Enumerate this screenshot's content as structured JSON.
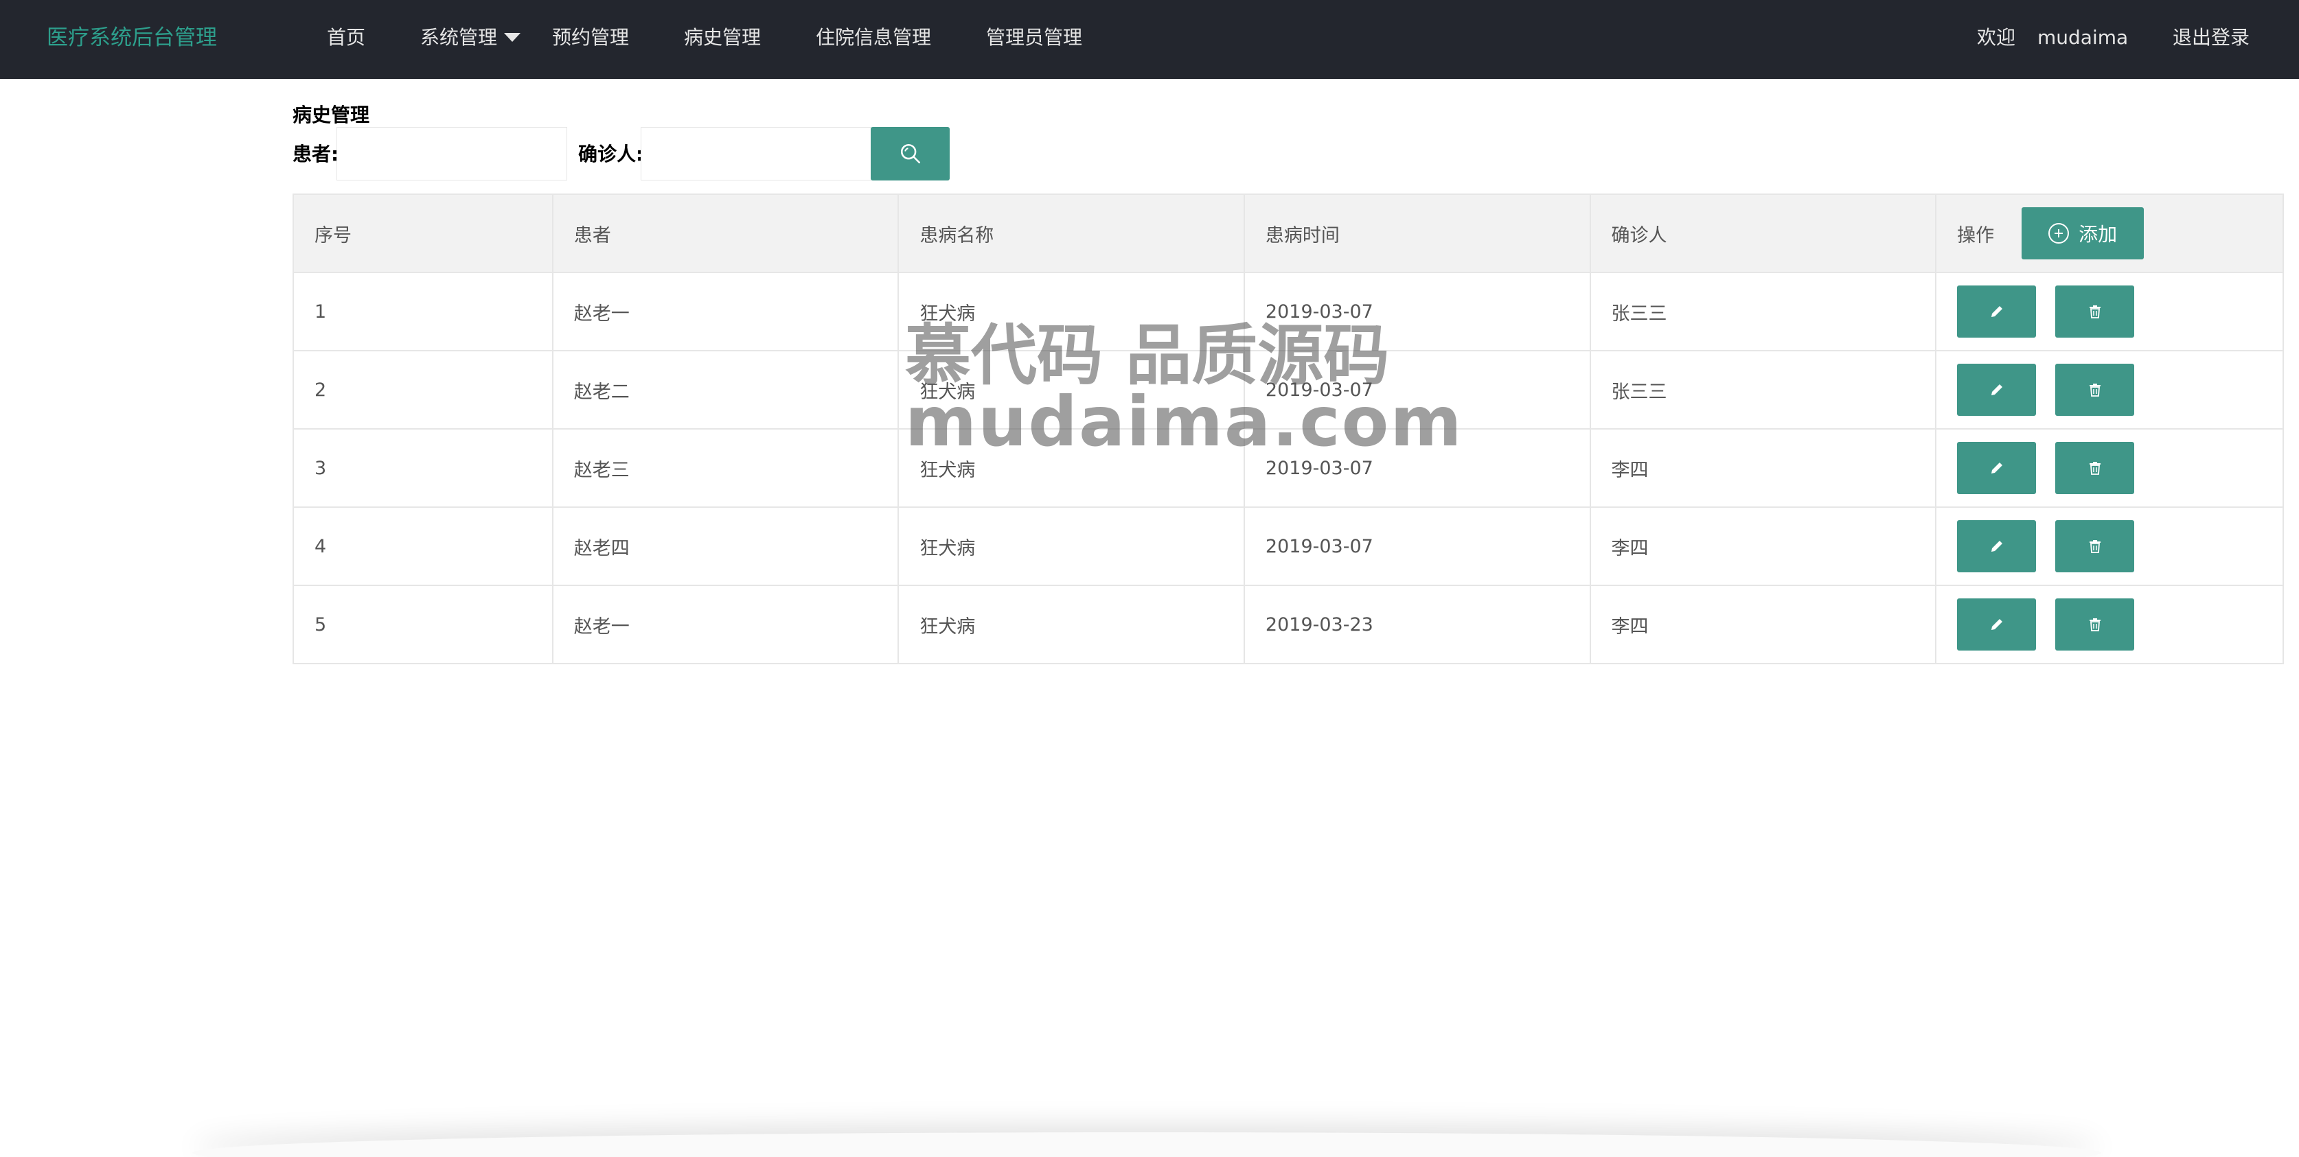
{
  "header": {
    "brand": "医疗系统后台管理",
    "nav": [
      {
        "label": "首页"
      },
      {
        "label": "系统管理"
      },
      {
        "label": "预约管理"
      },
      {
        "label": "病史管理"
      },
      {
        "label": "住院信息管理"
      },
      {
        "label": "管理员管理"
      }
    ],
    "welcome": "欢迎",
    "username": "mudaima",
    "logout": "退出登录"
  },
  "page": {
    "title": "病史管理",
    "search": {
      "patient_label": "患者:",
      "patient_value": "",
      "doctor_label": "确诊人:",
      "doctor_value": ""
    }
  },
  "table": {
    "columns": [
      "序号",
      "患者",
      "患病名称",
      "患病时间",
      "确诊人",
      "操作"
    ],
    "add_label": "添加",
    "rows": [
      {
        "id": "1",
        "patient": "赵老一",
        "disease": "狂犬病",
        "date": "2019-03-07",
        "doctor": "张三三"
      },
      {
        "id": "2",
        "patient": "赵老二",
        "disease": "狂犬病",
        "date": "2019-03-07",
        "doctor": "张三三"
      },
      {
        "id": "3",
        "patient": "赵老三",
        "disease": "狂犬病",
        "date": "2019-03-07",
        "doctor": "李四"
      },
      {
        "id": "4",
        "patient": "赵老四",
        "disease": "狂犬病",
        "date": "2019-03-07",
        "doctor": "李四"
      },
      {
        "id": "5",
        "patient": "赵老一",
        "disease": "狂犬病",
        "date": "2019-03-23",
        "doctor": "李四"
      }
    ]
  },
  "watermark": {
    "line1": "慕代码 品质源码",
    "line2": "mudaima.com"
  },
  "icons": {
    "search": "search-icon",
    "add": "plus-circle-icon",
    "edit": "pencil-icon",
    "delete": "trash-icon"
  },
  "colors": {
    "topbar": "#23262e",
    "brand": "#2d9f8c",
    "accent": "#3f9688"
  }
}
